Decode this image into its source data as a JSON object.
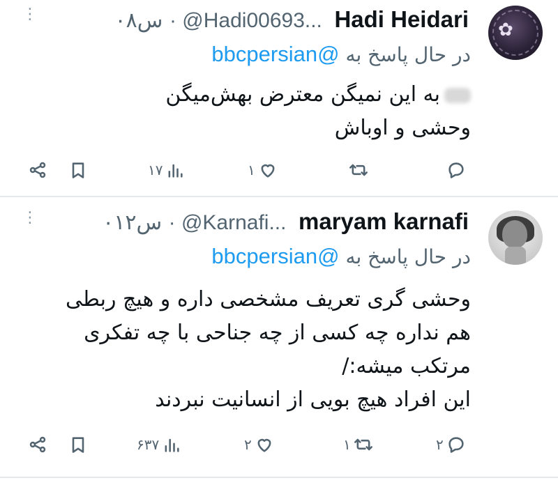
{
  "tweets": [
    {
      "name": "Hadi Heidari",
      "handle": "@Hadi00693...",
      "time": "۰س۸",
      "reply_label": "در حال پاسخ به",
      "reply_mention": "@bbcpersian",
      "body_line1_rest": "به این نمیگن معترض بهش‌میگن",
      "body_line2": "وحشی و اوباش",
      "stats": {
        "replies": "",
        "retweets": "",
        "likes": "۱",
        "views": "۱۷"
      }
    },
    {
      "name": "maryam karnafi",
      "handle": "@Karnafi...",
      "time": "۰س۱۲",
      "reply_label": "در حال پاسخ به",
      "reply_mention": "@bbcpersian",
      "body_lines": [
        "وحشی گری تعریف مشخصی داره و هیچ ربطی",
        "هم نداره چه کسی از چه جناحی با چه تفکری",
        "مرتکب میشه:/",
        "این افراد هیچ بویی از انسانیت نبردند"
      ],
      "stats": {
        "replies": "۲",
        "retweets": "۱",
        "likes": "۲",
        "views": "۶۳۷"
      }
    }
  ],
  "icons": {
    "more": "more-dots-icon",
    "reply": "reply-icon",
    "retweet": "retweet-icon",
    "like": "heart-icon",
    "views": "views-icon",
    "bookmark": "bookmark-icon",
    "share": "share-icon"
  },
  "colors": {
    "accent": "#1d9bf0",
    "muted": "#536471",
    "text": "#0f1419"
  }
}
